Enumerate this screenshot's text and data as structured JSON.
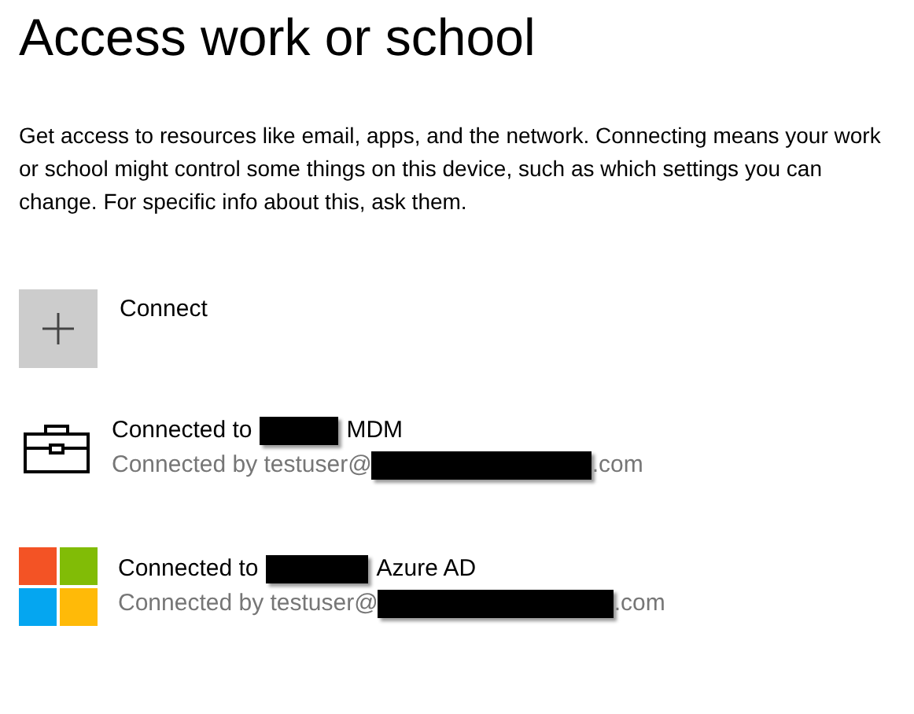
{
  "page_title": "Access work or school",
  "description": "Get access to resources like email, apps, and the network. Connecting means your work or school might control some things on this device, such as which settings you can change. For specific info about this, ask them.",
  "connect": {
    "label": "Connect"
  },
  "accounts": [
    {
      "kind": "mdm",
      "title_before": "Connected to",
      "title_after": "MDM",
      "detail_before": "Connected by testuser@",
      "detail_after": ".com"
    },
    {
      "kind": "azure",
      "title_before": "Connected to",
      "title_after": "Azure AD",
      "detail_before": "Connected by testuser@",
      "detail_after": ".com"
    }
  ]
}
